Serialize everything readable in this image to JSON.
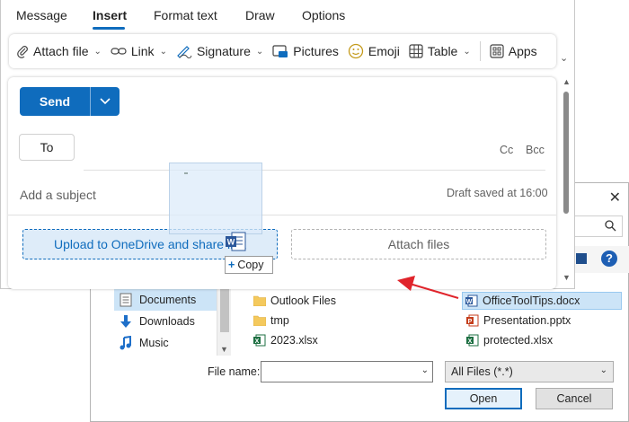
{
  "outlook": {
    "tabs": [
      "Message",
      "Insert",
      "Format text",
      "Draw",
      "Options"
    ],
    "active_tab": "Insert",
    "ribbon": {
      "attach_file": "Attach file",
      "link": "Link",
      "signature": "Signature",
      "pictures": "Pictures",
      "emoji": "Emoji",
      "table": "Table",
      "apps": "Apps"
    },
    "compose": {
      "send_label": "Send",
      "to_label": "To",
      "cc_label": "Cc",
      "bcc_label": "Bcc",
      "subject_placeholder": "Add a subject",
      "draft_status": "Draft saved at 16:00",
      "upload_onedrive": "Upload to OneDrive and share link",
      "attach_files": "Attach files"
    },
    "drag_tooltip": "Copy"
  },
  "file_dialog": {
    "nav_items": [
      {
        "label": "Documents",
        "icon": "documents-icon",
        "selected": true
      },
      {
        "label": "Downloads",
        "icon": "downloads-icon",
        "selected": false
      },
      {
        "label": "Music",
        "icon": "music-icon",
        "selected": false
      }
    ],
    "files": [
      {
        "name": "Outlook Files",
        "type": "folder"
      },
      {
        "name": "tmp",
        "type": "folder"
      },
      {
        "name": "2023.xlsx",
        "type": "excel"
      },
      {
        "name": "OfficeToolTips.docx",
        "type": "word",
        "selected": true
      },
      {
        "name": "Presentation.pptx",
        "type": "powerpoint"
      },
      {
        "name": "protected.xlsx",
        "type": "excel"
      }
    ],
    "file_name_label": "File name:",
    "file_name_value": "",
    "filter_value": "All Files (*.*)",
    "open_label": "Open",
    "cancel_label": "Cancel"
  },
  "colors": {
    "accent": "#0f6cbd",
    "arrow": "#e0242b",
    "selection": "#cce4f7"
  }
}
